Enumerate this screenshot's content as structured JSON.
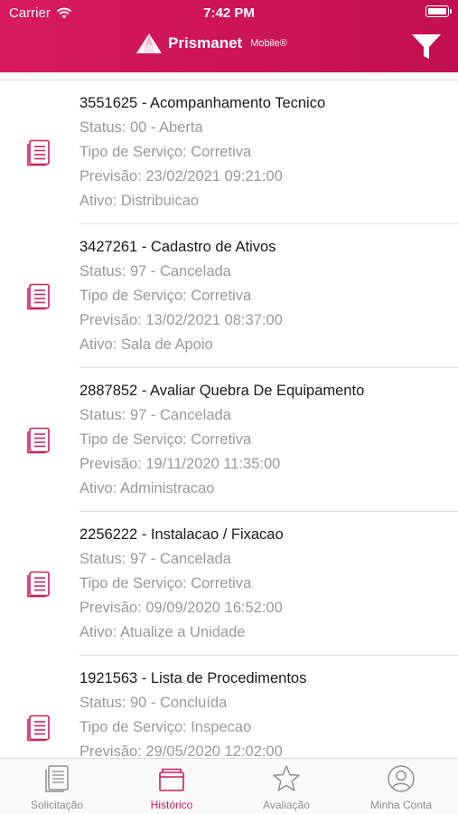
{
  "status_bar": {
    "carrier": "Carrier",
    "time": "7:42 PM"
  },
  "header": {
    "brand_name": "Prismanet",
    "brand_suffix": "Mobile®",
    "filter_icon": "filter-icon"
  },
  "items": [
    {
      "title": "3551625 - Acompanhamento Tecnico",
      "status": "Status: 00 - Aberta",
      "tipo": "Tipo de Serviço: Corretiva",
      "previsao": "Previsão: 23/02/2021 09:21:00",
      "ativo": "Ativo: Distribuicao"
    },
    {
      "title": "3427261 - Cadastro de Ativos",
      "status": "Status: 97 - Cancelada",
      "tipo": "Tipo de Serviço: Corretiva",
      "previsao": "Previsão: 13/02/2021 08:37:00",
      "ativo": "Ativo: Sala de Apoio"
    },
    {
      "title": "2887852 - Avaliar Quebra De Equipamento",
      "status": "Status: 97 - Cancelada",
      "tipo": "Tipo de Serviço: Corretiva",
      "previsao": "Previsão: 19/11/2020 11:35:00",
      "ativo": "Ativo: Administracao"
    },
    {
      "title": "2256222 - Instalacao / Fixacao",
      "status": "Status: 97 - Cancelada",
      "tipo": "Tipo de Serviço: Corretiva",
      "previsao": "Previsão: 09/09/2020 16:52:00",
      "ativo": "Ativo: Atualize a Unidade"
    },
    {
      "title": "1921563 - Lista de Procedimentos",
      "status": "Status: 90 - Concluída",
      "tipo": "Tipo de Serviço: Inspecao",
      "previsao": "Previsão: 29/05/2020 12:02:00",
      "ativo": ""
    }
  ],
  "tabs": [
    {
      "label": "Solicitação",
      "icon": "document-icon",
      "active": false
    },
    {
      "label": "Histórico",
      "icon": "folder-icon",
      "active": true
    },
    {
      "label": "Avaliação",
      "icon": "star-icon",
      "active": false
    },
    {
      "label": "Minha Conta",
      "icon": "user-icon",
      "active": false
    }
  ],
  "colors": {
    "brand": "#d01a5c",
    "inactive": "#8e8e8e"
  }
}
